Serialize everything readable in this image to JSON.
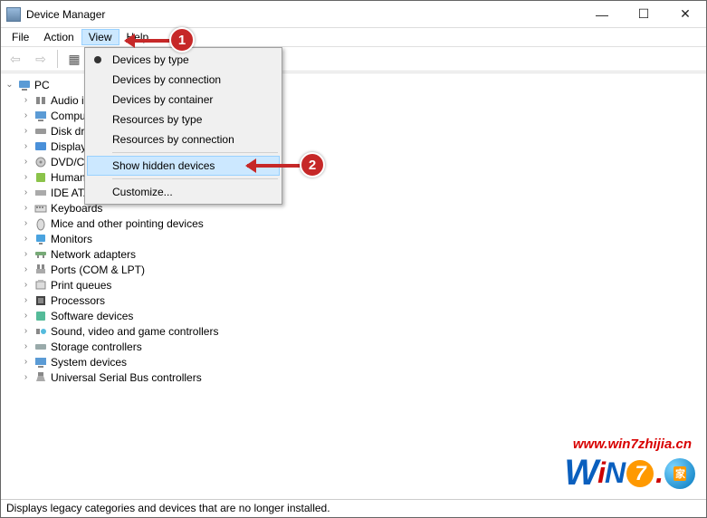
{
  "window": {
    "title": "Device Manager",
    "controls": {
      "min": "—",
      "max": "☐",
      "close": "✕"
    }
  },
  "menubar": {
    "items": [
      "File",
      "Action",
      "View",
      "Help"
    ],
    "open_index": 2
  },
  "toolbar": {
    "back": "⇦",
    "fwd": "⇨",
    "props": "▦",
    "help": "?"
  },
  "dropdown": {
    "items": [
      {
        "label": "Devices by type",
        "bullet": true
      },
      {
        "label": "Devices by connection"
      },
      {
        "label": "Devices by container"
      },
      {
        "label": "Resources by type"
      },
      {
        "label": "Resources by connection"
      }
    ],
    "highlighted": {
      "label": "Show hidden devices"
    },
    "customize": {
      "label": "Customize..."
    }
  },
  "tree": {
    "root": "PC",
    "items": [
      "Audio inputs and outputs",
      "Computer",
      "Disk drives",
      "Display adapters",
      "DVD/CD-ROM drives",
      "Human Interface Devices",
      "IDE ATA/ATAPI controllers",
      "Keyboards",
      "Mice and other pointing devices",
      "Monitors",
      "Network adapters",
      "Ports (COM & LPT)",
      "Print queues",
      "Processors",
      "Software devices",
      "Sound, video and game controllers",
      "Storage controllers",
      "System devices",
      "Universal Serial Bus controllers"
    ]
  },
  "statusbar": {
    "text": "Displays legacy categories and devices that are no longer installed."
  },
  "annotations": {
    "step1": "1",
    "step2": "2"
  },
  "watermark": {
    "url": "www.win7zhijia.cn",
    "logo_w": "W",
    "logo_i": "i",
    "logo_n": "N",
    "logo_7": "7",
    "logo_dot": ".",
    "logo_home": "家"
  }
}
